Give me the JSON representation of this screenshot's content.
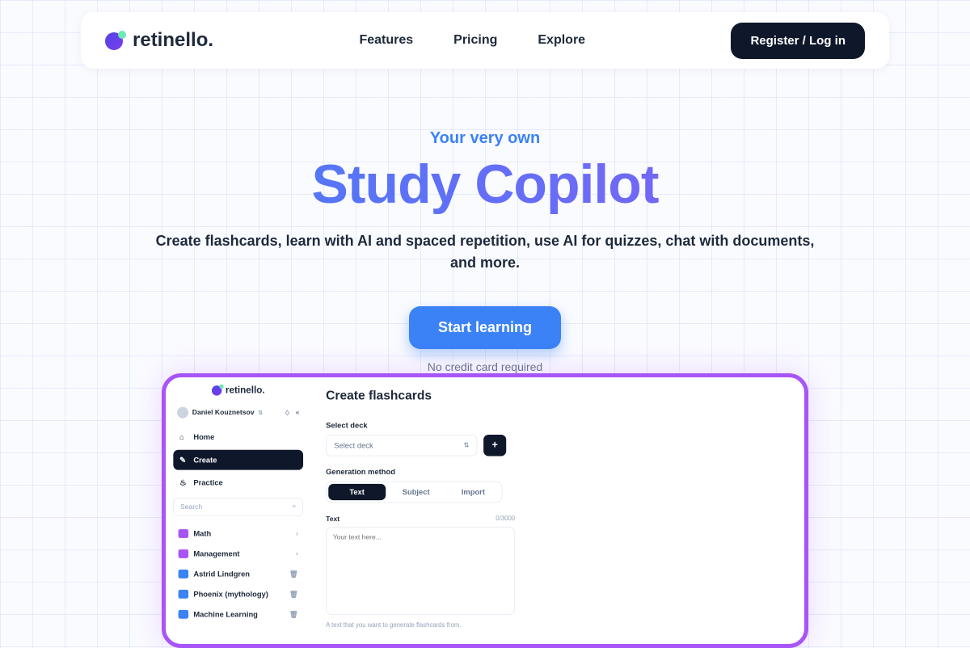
{
  "nav": {
    "brand": "retinello.",
    "links": [
      "Features",
      "Pricing",
      "Explore"
    ],
    "register": "Register / Log in"
  },
  "hero": {
    "eyebrow": "Your very own",
    "title": "Study Copilot",
    "subtitle": "Create flashcards, learn with AI and spaced repetition, use AI for quizzes, chat with documents, and more.",
    "cta": "Start learning",
    "note": "No credit card required"
  },
  "preview": {
    "brand": "retinello.",
    "user": "Daniel Kouznetsov",
    "nav_items": [
      {
        "icon": "home",
        "label": "Home",
        "active": false
      },
      {
        "icon": "pencil",
        "label": "Create",
        "active": true
      },
      {
        "icon": "practice",
        "label": "Practice",
        "active": false
      }
    ],
    "search_placeholder": "Search",
    "decks": [
      {
        "type": "folder",
        "name": "Math",
        "action": "chev"
      },
      {
        "type": "folder",
        "name": "Management",
        "action": "chev"
      },
      {
        "type": "doc",
        "name": "Astrid Lindgren",
        "action": "trash"
      },
      {
        "type": "doc",
        "name": "Phoenix (mythology)",
        "action": "trash"
      },
      {
        "type": "doc",
        "name": "Machine Learning",
        "action": "trash"
      }
    ],
    "main": {
      "title": "Create flashcards",
      "select_label": "Select deck",
      "select_placeholder": "Select deck",
      "gen_label": "Generation method",
      "tabs": [
        "Text",
        "Subject",
        "Import"
      ],
      "text_label": "Text",
      "counter": "0/3000",
      "textarea_placeholder": "Your text here...",
      "hint": "A text that you want to generate flashcards from."
    }
  }
}
